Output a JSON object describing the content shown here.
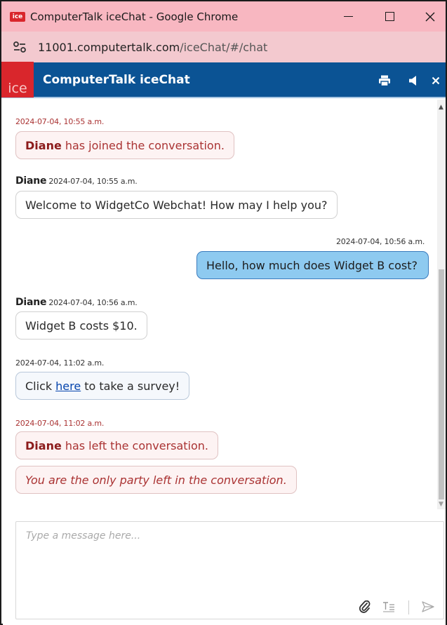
{
  "browser": {
    "window_title": "ComputerTalk iceChat - Google Chrome",
    "favicon_text": "ice",
    "url_host": "11001.computertalk.com",
    "url_path": "/iceChat/#/chat",
    "controls": {
      "minimize": "minimize-icon",
      "maximize": "maximize-icon",
      "close": "close-icon"
    }
  },
  "app": {
    "logo_text": "ice",
    "title": "ComputerTalk iceChat",
    "header_icons": [
      "print-icon",
      "speaker-icon",
      "close-icon"
    ],
    "colors": {
      "header": "#0b5394",
      "logo": "#d9262c",
      "customer_bubble": "#8ecaf0",
      "system_text": "#aa3333"
    }
  },
  "messages": [
    {
      "type": "system",
      "timestamp": "2024-07-04, 10:55 a.m.",
      "who": "Diane",
      "text": "has joined the conversation."
    },
    {
      "type": "agent",
      "sender": "Diane",
      "timestamp": "2024-07-04, 10:55 a.m.",
      "text": "Welcome to WidgetCo Webchat! How may I help you?"
    },
    {
      "type": "customer",
      "timestamp": "2024-07-04, 10:56 a.m.",
      "text": "Hello, how much does Widget B cost?"
    },
    {
      "type": "agent",
      "sender": "Diane",
      "timestamp": "2024-07-04, 10:56 a.m.",
      "text": "Widget B costs $10."
    },
    {
      "type": "survey",
      "timestamp": "2024-07-04, 11:02 a.m.",
      "prefix": "Click",
      "link": "here",
      "suffix": "to take a survey!"
    },
    {
      "type": "system",
      "timestamp": "2024-07-04, 11:02 a.m.",
      "who": "Diane",
      "text": "has left the conversation."
    },
    {
      "type": "system-italic",
      "text": "You are the only party left in the conversation."
    }
  ],
  "composer": {
    "placeholder": "Type a message here...",
    "tools": [
      "paperclip-icon",
      "text-format-icon",
      "send-icon"
    ]
  }
}
